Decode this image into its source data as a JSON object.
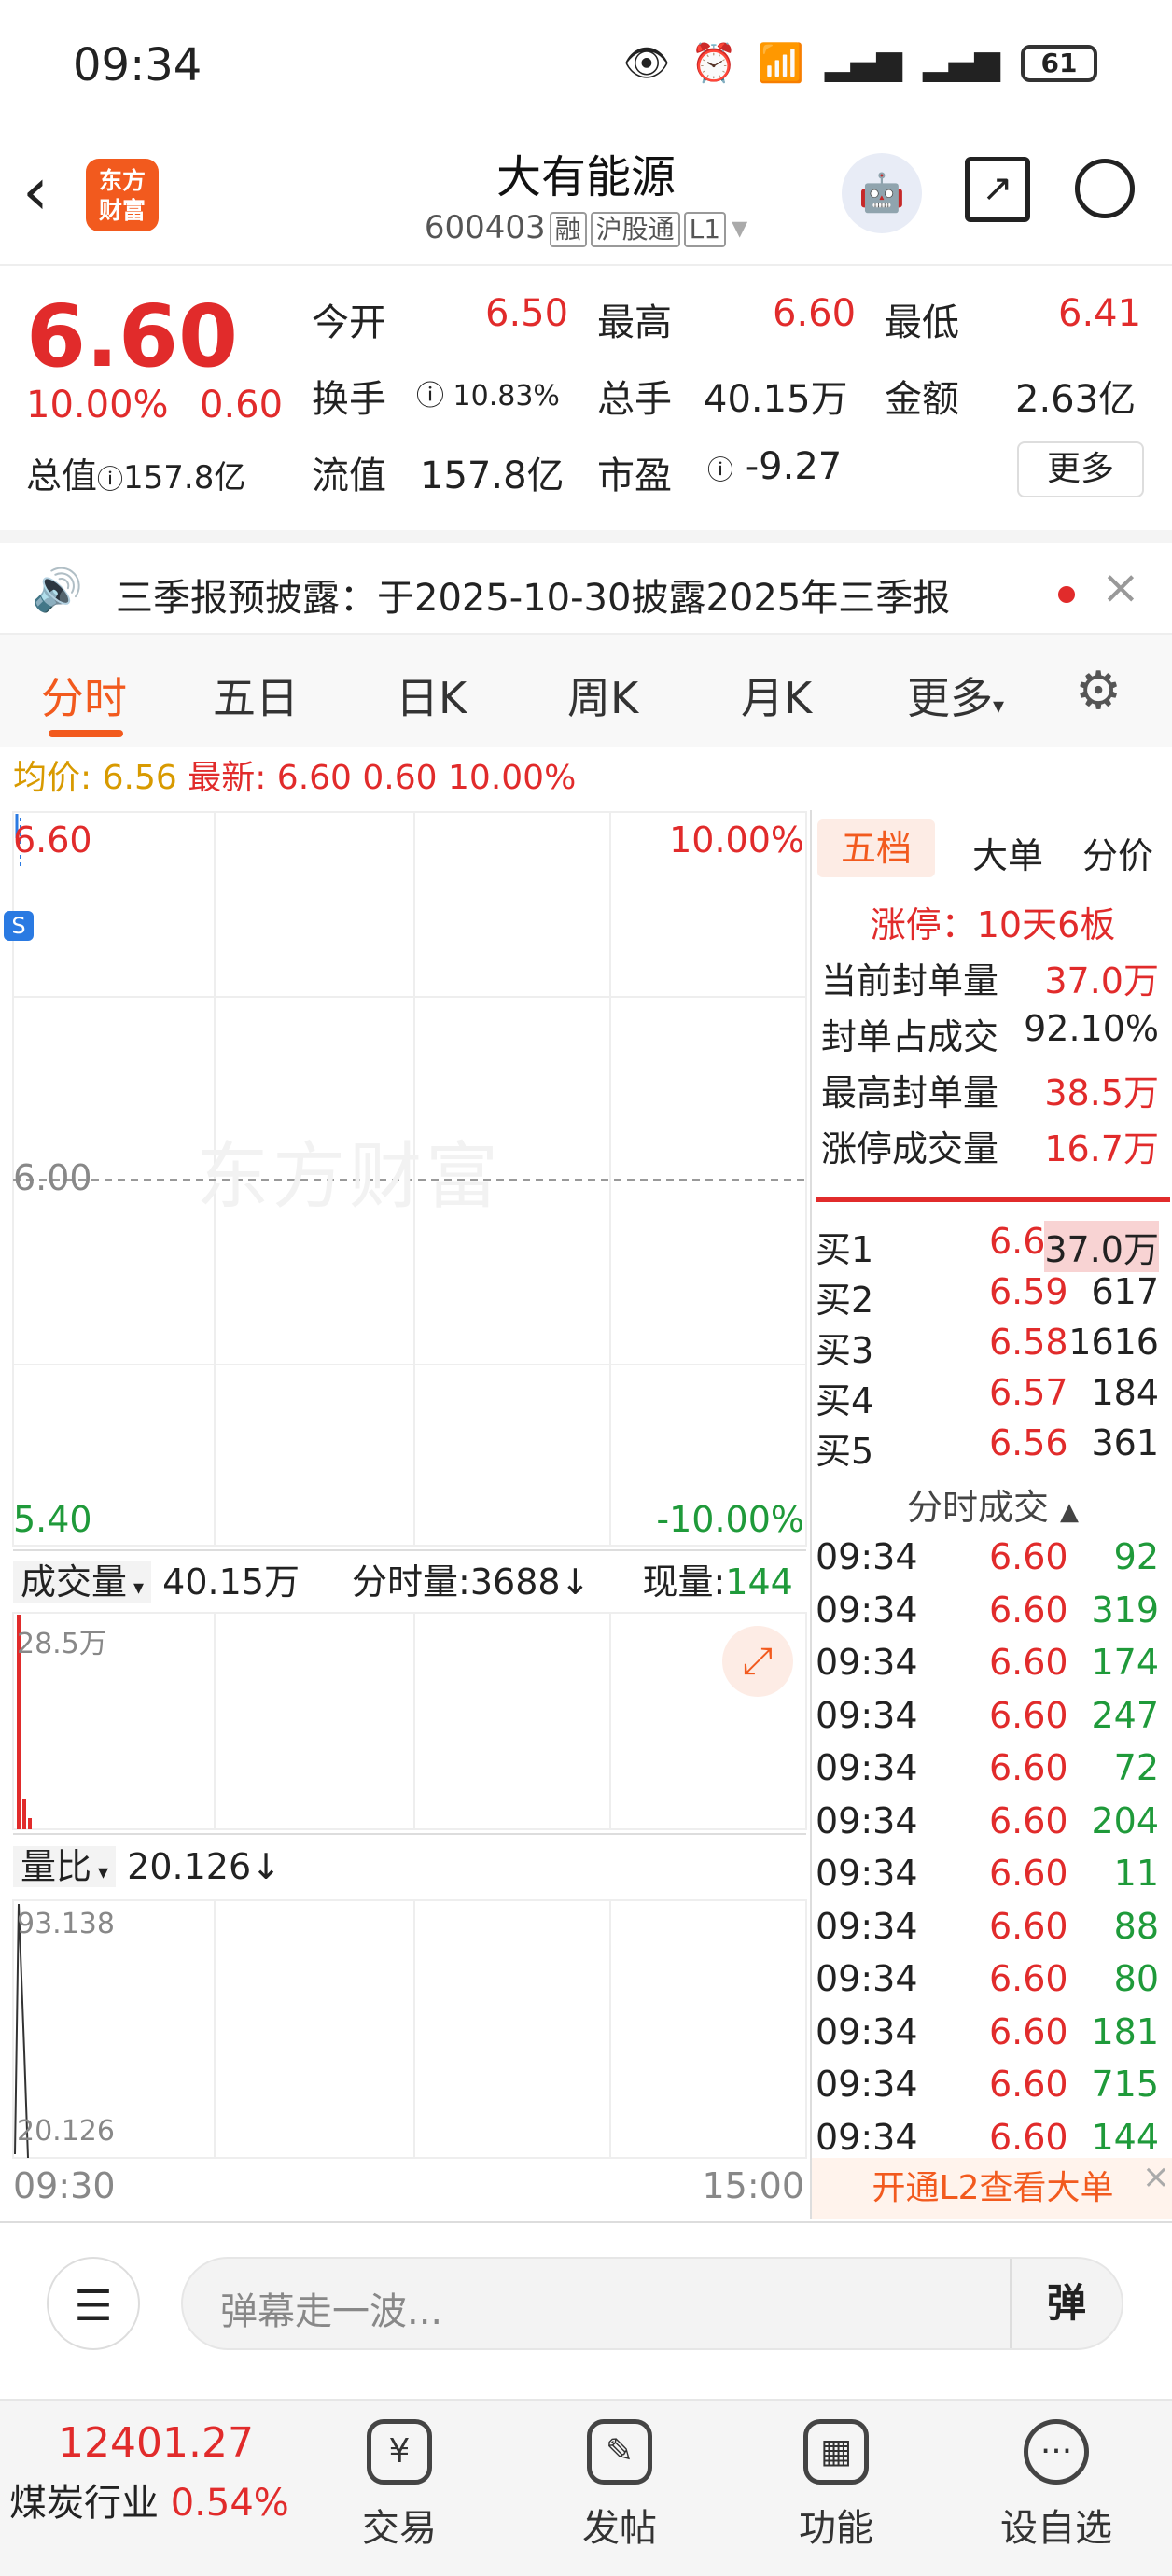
{
  "status": {
    "time": "09:34",
    "battery": "61"
  },
  "nav": {
    "title": "大有能源",
    "code": "600403",
    "tags": [
      "融",
      "沪股通",
      "L1"
    ],
    "logo_line1": "东方",
    "logo_line2": "财富"
  },
  "quote": {
    "price": "6.60",
    "pct": "10.00%",
    "chg": "0.60",
    "open_l": "今开",
    "open": "6.50",
    "high_l": "最高",
    "high": "6.60",
    "low_l": "最低",
    "low": "6.41",
    "turn_l": "换手",
    "turn": "10.83%",
    "vol_l": "总手",
    "vol": "40.15万",
    "amt_l": "金额",
    "amt": "2.63亿",
    "mcap_l": "总值",
    "mcap": "157.8亿",
    "float_l": "流值",
    "float": "157.8亿",
    "pe_l": "市盈",
    "pe": "-9.27",
    "more": "更多"
  },
  "notice": "三季报预披露：于2025-10-30披露2025年三季报",
  "tabs": [
    "分时",
    "五日",
    "日K",
    "周K",
    "月K",
    "更多"
  ],
  "avg": {
    "label1": "均价:",
    "avg": "6.56",
    "label2": "最新:",
    "last": "6.60",
    "chg": "0.60",
    "pct": "10.00%"
  },
  "chart": {
    "top_price": "6.60",
    "top_pct": "10.00%",
    "mid_price": "6.00",
    "bot_price": "5.40",
    "bot_pct": "-10.00%",
    "watermark": "东方财富",
    "vol_label": "成交量",
    "vol_total": "40.15万",
    "vol_ft": "分时量:3688↓",
    "vol_now_l": "现量:",
    "vol_now": "144",
    "vol_max": "28.5万",
    "lb_label": "量比",
    "lb_value": "20.126↓",
    "lb_max": "93.138",
    "lb_min": "20.126",
    "t_start": "09:30",
    "t_end": "15:00"
  },
  "right": {
    "tabs": [
      "五档",
      "大单",
      "分价"
    ],
    "limit": "涨停：10天6板",
    "stats": [
      {
        "k": "当前封单量",
        "v": "37.0万"
      },
      {
        "k": "封单占成交",
        "v": "92.10%"
      },
      {
        "k": "最高封单量",
        "v": "38.5万"
      },
      {
        "k": "涨停成交量",
        "v": "16.7万"
      }
    ],
    "bids": [
      {
        "k": "买1",
        "p": "6.60",
        "v": "37.0万"
      },
      {
        "k": "买2",
        "p": "6.59",
        "v": "617"
      },
      {
        "k": "买3",
        "p": "6.58",
        "v": "1616"
      },
      {
        "k": "买4",
        "p": "6.57",
        "v": "184"
      },
      {
        "k": "买5",
        "p": "6.56",
        "v": "361"
      }
    ],
    "ticks_title": "分时成交",
    "ticks": [
      {
        "t": "09:34",
        "p": "6.60",
        "v": "92"
      },
      {
        "t": "09:34",
        "p": "6.60",
        "v": "319"
      },
      {
        "t": "09:34",
        "p": "6.60",
        "v": "174"
      },
      {
        "t": "09:34",
        "p": "6.60",
        "v": "247"
      },
      {
        "t": "09:34",
        "p": "6.60",
        "v": "72"
      },
      {
        "t": "09:34",
        "p": "6.60",
        "v": "204"
      },
      {
        "t": "09:34",
        "p": "6.60",
        "v": "11"
      },
      {
        "t": "09:34",
        "p": "6.60",
        "v": "88"
      },
      {
        "t": "09:34",
        "p": "6.60",
        "v": "80"
      },
      {
        "t": "09:34",
        "p": "6.60",
        "v": "181"
      },
      {
        "t": "09:34",
        "p": "6.60",
        "v": "715"
      },
      {
        "t": "09:34",
        "p": "6.60",
        "v": "144"
      }
    ],
    "l2": "开通L2查看大单"
  },
  "input": {
    "placeholder": "弹幕走一波...",
    "dm": "弹"
  },
  "tabbar": {
    "index_value": "12401.27",
    "index_name": "煤炭行业",
    "index_pct": "0.54%",
    "items": [
      "交易",
      "发帖",
      "功能",
      "设自选"
    ]
  }
}
